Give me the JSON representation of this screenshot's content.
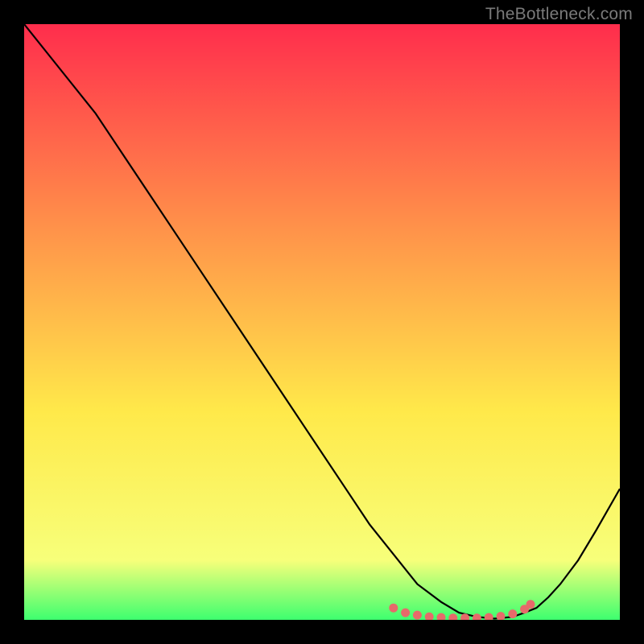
{
  "watermark": "TheBottleneck.com",
  "chart_data": {
    "type": "line",
    "title": "",
    "xlabel": "",
    "ylabel": "",
    "xlim": [
      0,
      100
    ],
    "ylim": [
      0,
      100
    ],
    "background_gradient": {
      "top": "#ff2d4c",
      "mid1": "#ff944a",
      "mid2": "#ffe94a",
      "bottom1": "#f7ff7a",
      "bottom2": "#3dff6f"
    },
    "series": [
      {
        "name": "curve",
        "x": [
          0,
          4,
          8,
          12,
          18,
          24,
          30,
          36,
          42,
          48,
          54,
          58,
          62,
          66,
          70,
          73,
          76,
          79,
          82,
          84,
          86,
          88,
          90,
          93,
          96,
          100
        ],
        "y": [
          100,
          95,
          90,
          85,
          76,
          67,
          58,
          49,
          40,
          31,
          22,
          16,
          11,
          6,
          3,
          1.2,
          0.5,
          0.2,
          0.5,
          1.2,
          2,
          3.8,
          6,
          10,
          15,
          22
        ]
      }
    ],
    "dotted_region": {
      "x": [
        62,
        64,
        66,
        68,
        70,
        72,
        74,
        76,
        78,
        80,
        82,
        84,
        85
      ],
      "y": [
        2.0,
        1.2,
        0.8,
        0.5,
        0.4,
        0.3,
        0.3,
        0.3,
        0.4,
        0.6,
        1.0,
        1.8,
        2.6
      ]
    },
    "dot_color": "#e66a6a",
    "line_color": "#000000"
  }
}
